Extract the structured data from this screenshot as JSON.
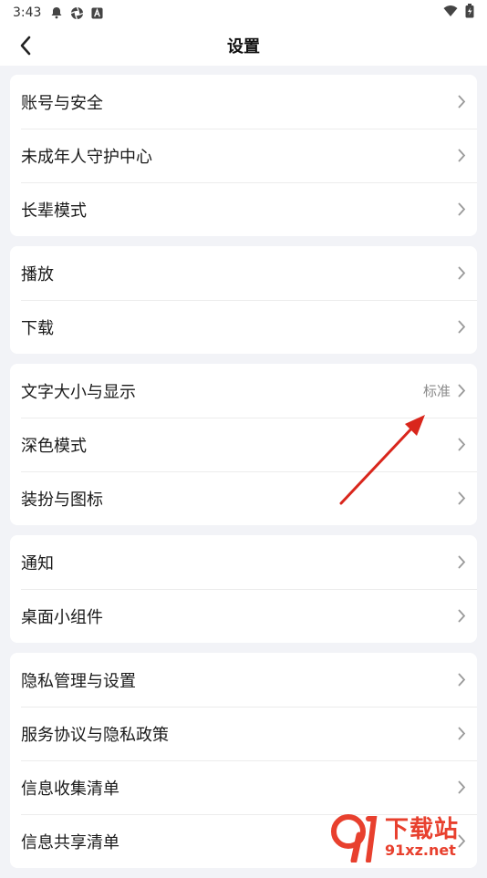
{
  "status_bar": {
    "time": "3:43",
    "icons": [
      "bell-icon",
      "camera-aperture-icon",
      "app-a-icon"
    ],
    "right_icons": [
      "wifi-icon",
      "battery-icon"
    ]
  },
  "header": {
    "title": "设置",
    "back_icon": "chevron-left-icon"
  },
  "groups": [
    {
      "items": [
        {
          "label": "账号与安全"
        },
        {
          "label": "未成年人守护中心"
        },
        {
          "label": "长辈模式"
        }
      ]
    },
    {
      "items": [
        {
          "label": "播放"
        },
        {
          "label": "下载"
        }
      ]
    },
    {
      "items": [
        {
          "label": "文字大小与显示",
          "value": "标准"
        },
        {
          "label": "深色模式"
        },
        {
          "label": "装扮与图标"
        }
      ]
    },
    {
      "items": [
        {
          "label": "通知"
        },
        {
          "label": "桌面小组件"
        }
      ]
    },
    {
      "items": [
        {
          "label": "隐私管理与设置"
        },
        {
          "label": "服务协议与隐私政策"
        },
        {
          "label": "信息收集清单"
        },
        {
          "label": "信息共享清单"
        }
      ]
    }
  ],
  "watermark": {
    "title": "下载站",
    "site": "91xz.net"
  },
  "colors": {
    "accent_red": "#e8402e",
    "background": "#f2f3f7",
    "card": "#ffffff"
  }
}
